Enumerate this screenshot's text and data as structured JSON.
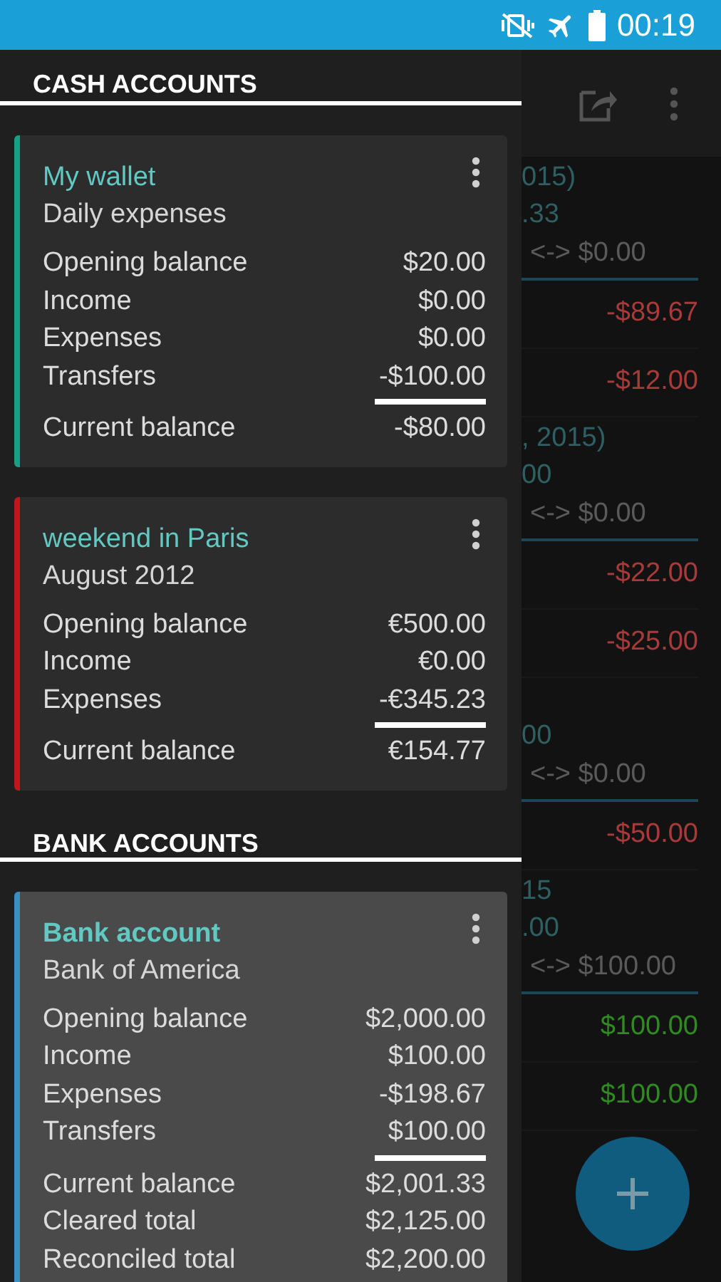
{
  "status_bar": {
    "time": "00:19"
  },
  "transactions": [
    {
      "kind": "group",
      "lines": [
        "015)",
        ".33",
        "<-> $0.00"
      ]
    },
    {
      "kind": "amount",
      "amount": "-$89.67",
      "color": "#a83a3a"
    },
    {
      "kind": "amount",
      "amount": "-$12.00",
      "color": "#a83a3a"
    },
    {
      "kind": "group",
      "lines": [
        ", 2015)",
        "00",
        "<-> $0.00"
      ]
    },
    {
      "kind": "amount",
      "amount": "-$22.00",
      "color": "#a83a3a"
    },
    {
      "kind": "amount",
      "amount": "-$25.00",
      "color": "#a83a3a"
    },
    {
      "kind": "group",
      "lines": [
        "00",
        "<-> $0.00"
      ]
    },
    {
      "kind": "amount",
      "amount": "-$50.00",
      "color": "#a83a3a"
    },
    {
      "kind": "group",
      "lines": [
        "15",
        ".00",
        "<-> $100.00"
      ]
    },
    {
      "kind": "amount",
      "amount": "$100.00",
      "color": "#2f8a22"
    },
    {
      "kind": "amount",
      "amount": "$100.00",
      "color": "#2f8a22"
    }
  ],
  "drawer": {
    "sections": [
      {
        "title": "CASH ACCOUNTS",
        "accounts": [
          {
            "name": "My wallet",
            "description": "Daily expenses",
            "color": "#16a085",
            "selected": false,
            "rows": [
              {
                "label": "Opening balance",
                "value": "$20.00"
              },
              {
                "label": "Income",
                "value": "$0.00"
              },
              {
                "label": "Expenses",
                "value": "$0.00"
              },
              {
                "label": "Transfers",
                "value": "-$100.00"
              }
            ],
            "totals": [
              {
                "label": "Current balance",
                "value": "-$80.00"
              }
            ]
          },
          {
            "name": "weekend in Paris",
            "description": "August 2012",
            "color": "#c0161c",
            "selected": false,
            "rows": [
              {
                "label": "Opening balance",
                "value": "€500.00"
              },
              {
                "label": "Income",
                "value": "€0.00"
              },
              {
                "label": "Expenses",
                "value": "-€345.23"
              }
            ],
            "totals": [
              {
                "label": "Current balance",
                "value": "€154.77"
              }
            ]
          }
        ]
      },
      {
        "title": "BANK ACCOUNTS",
        "accounts": [
          {
            "name": "Bank account",
            "description": "Bank of America",
            "color": "#3a8fc0",
            "selected": true,
            "rows": [
              {
                "label": "Opening balance",
                "value": "$2,000.00"
              },
              {
                "label": "Income",
                "value": "$100.00"
              },
              {
                "label": "Expenses",
                "value": "-$198.67"
              },
              {
                "label": "Transfers",
                "value": "$100.00"
              }
            ],
            "totals": [
              {
                "label": "Current balance",
                "value": "$2,001.33"
              },
              {
                "label": "Cleared total",
                "value": "$2,125.00"
              },
              {
                "label": "Reconciled total",
                "value": "$2,200.00"
              }
            ]
          }
        ]
      }
    ]
  }
}
